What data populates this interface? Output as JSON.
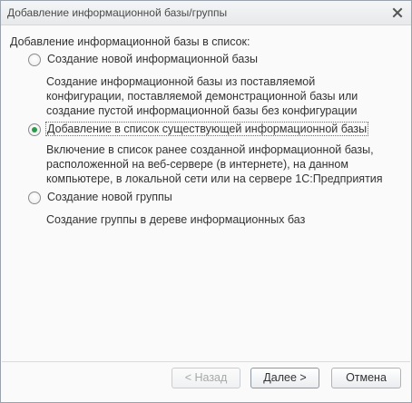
{
  "window": {
    "title": "Добавление информационной базы/группы",
    "close_icon": "close-icon"
  },
  "intro": "Добавление информационной базы в список:",
  "options": [
    {
      "label": "Создание новой информационной базы",
      "checked": false,
      "description": [
        "Создание информационной базы из поставляемой",
        "конфигурации, поставляемой демонстрационной базы или",
        "создание пустой информационной базы без конфигурации"
      ]
    },
    {
      "label": "Добавление в список существующей информационной базы",
      "checked": true,
      "description": [
        "Включение в список ранее созданной информационной базы,",
        "расположенной на веб-сервере (в интернете), на данном",
        "компьютере,  в локальной сети или на сервере 1С:Предприятия"
      ]
    },
    {
      "label": "Создание новой группы",
      "checked": false,
      "description": [
        "Создание группы в дереве информационных баз"
      ]
    }
  ],
  "buttons": {
    "back": "< Назад",
    "next": "Далее >",
    "cancel": "Отмена"
  },
  "colors": {
    "radio_checked": "#2c9a4b"
  }
}
